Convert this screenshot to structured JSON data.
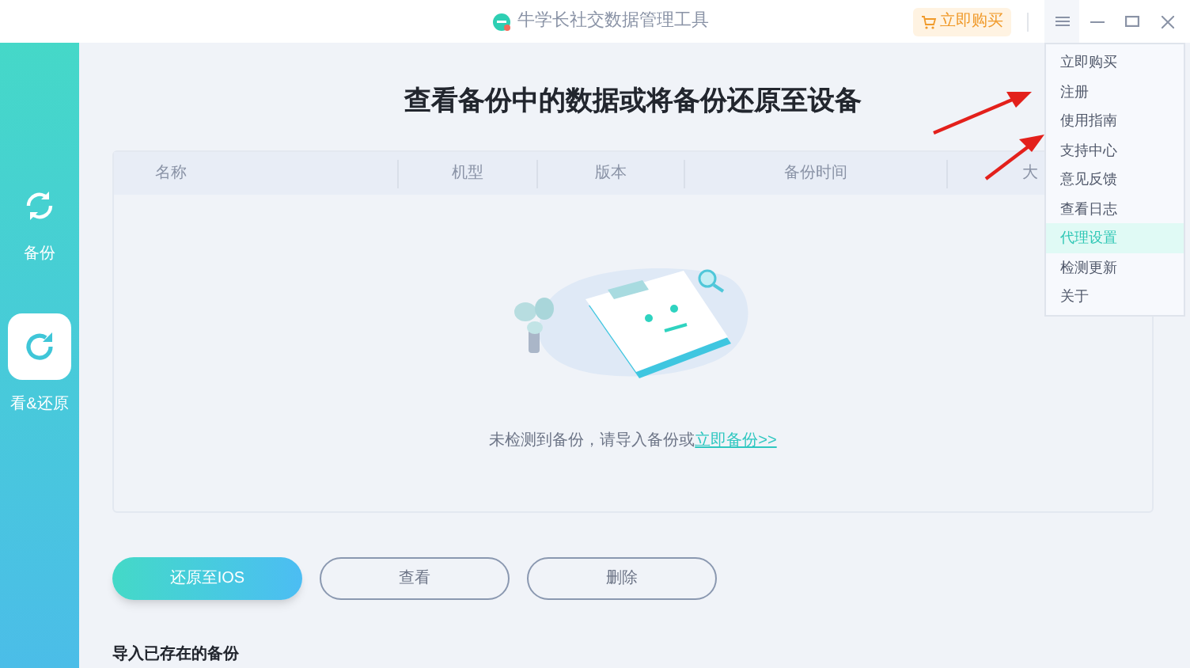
{
  "window": {
    "title": "牛学长社交数据管理工具",
    "buy_button": "立即购买"
  },
  "sidebar": {
    "items": [
      {
        "label": "备份",
        "kind": "backup",
        "selected": false
      },
      {
        "label": "看&还原",
        "kind": "restore",
        "selected": true
      }
    ]
  },
  "heading": "查看备份中的数据或将备份还原至设备",
  "table": {
    "columns": [
      "名称",
      "机型",
      "版本",
      "备份时间",
      "大"
    ],
    "empty_message": "未检测到备份，请导入备份或",
    "empty_link": "立即备份>>"
  },
  "buttons": [
    {
      "label": "还原至IOS",
      "kind": "primary"
    },
    {
      "label": "查看",
      "kind": "outline"
    },
    {
      "label": "删除",
      "kind": "outline"
    }
  ],
  "import_label": "导入已存在的备份",
  "menu": {
    "items": [
      {
        "label": "立即购买",
        "selected": false
      },
      {
        "label": "注册",
        "selected": false
      },
      {
        "label": "使用指南",
        "selected": false
      },
      {
        "label": "支持中心",
        "selected": false
      },
      {
        "label": "意见反馈",
        "selected": false
      },
      {
        "label": "查看日志",
        "selected": false
      },
      {
        "label": "代理设置",
        "selected": true
      },
      {
        "label": "检测更新",
        "selected": false
      },
      {
        "label": "关于",
        "selected": false
      }
    ]
  }
}
